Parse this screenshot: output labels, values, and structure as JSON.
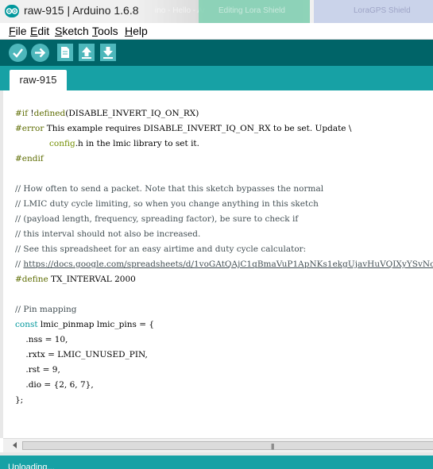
{
  "window": {
    "title": "raw-915 | Arduino 1.6.8",
    "background_tabs": [
      "ino - Hello - Ar",
      "Editing Lora Shield",
      "LoraGPS Shield"
    ]
  },
  "menu": {
    "items": [
      {
        "accel": "F",
        "rest": "ile"
      },
      {
        "accel": "E",
        "rest": "dit"
      },
      {
        "accel": "S",
        "rest": "ketch"
      },
      {
        "accel": "T",
        "rest": "ools"
      },
      {
        "accel": "H",
        "rest": "elp"
      }
    ]
  },
  "toolbar": {
    "buttons": [
      "verify-icon",
      "upload-icon",
      "new-icon",
      "open-icon",
      "save-icon"
    ]
  },
  "tabs": {
    "active": "raw-915"
  },
  "code": {
    "l1a": "#if",
    "l1b": " !",
    "l1c": "defined",
    "l1d": "(DISABLE_INVERT_IQ_ON_RX)",
    "l2a": "#error",
    "l2b": " This example requires DISABLE_INVERT_IQ_ON_RX to be set. Update \\",
    "l3a": "config",
    "l3b": ".h in the lmic library to set it.",
    "l4": "#endif",
    "c1": "// How often to send a packet. Note that this sketch bypasses the normal",
    "c2": "// LMIC duty cycle limiting, so when you change anything in this sketch",
    "c3": "// (payload length, frequency, spreading factor), be sure to check if",
    "c4": "// this interval should not also be increased.",
    "c5": "// See this spreadsheet for an easy airtime and duty cycle calculator:",
    "c6a": "// ",
    "c6b": "https://docs.google.com/spreadsheets/d/1voGAtQAjC1qBmaVuP1ApNKs1ekgUjavHuVQIXyYSvNc",
    "d1a": "#define",
    "d1b": " TX_INTERVAL 2000",
    "pm": "// Pin mapping",
    "s1a": "const",
    "s1b": " lmic_pinmap lmic_pins = {",
    "s2": "    .nss = 10,",
    "s3": "    .rxtx = LMIC_UNUSED_PIN,",
    "s4": "    .rst = 9,",
    "s5": "    .dio = {2, 6, 7},",
    "s6": "};"
  },
  "console": {
    "text": "Uploading..."
  },
  "colors": {
    "toolbar": "#006468",
    "tabbar": "#17a1a5",
    "button": "#4db7bb",
    "comment": "#434f54",
    "keyword": "#728e00",
    "type": "#00979c"
  }
}
